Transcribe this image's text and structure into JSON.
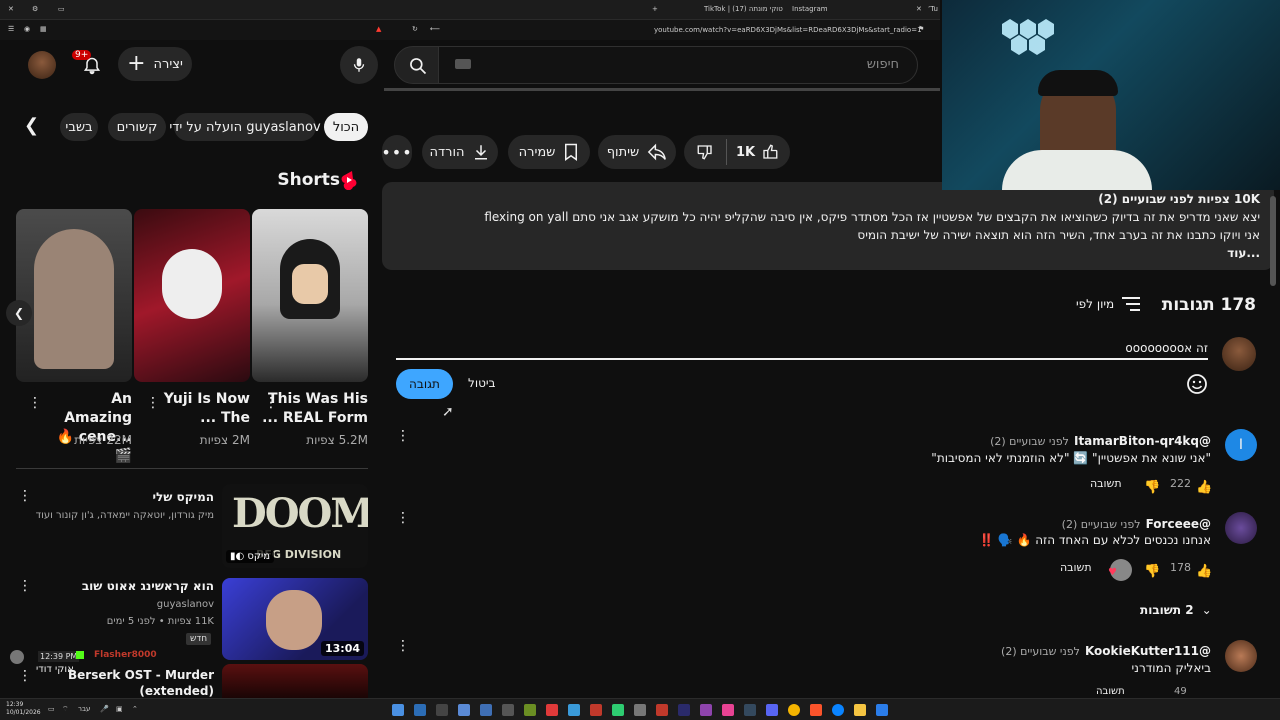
{
  "browser": {
    "tabs": [
      "TikTok | (17) טוקי מונתה",
      "Instagram",
      "’Tu"
    ],
    "url": "youtube.com/watch?v=eaRD6X3DjMs&list=RDeaRD6X3DjMs&start_radio=1"
  },
  "header": {
    "search_placeholder": "חיפוש",
    "create_label": "יצירה",
    "notif_badge": "9+"
  },
  "chips": [
    "הכול",
    "הועלה על ידי guyaslanov",
    "קשורים",
    "בשבי"
  ],
  "shorts": {
    "title": "Shorts",
    "items": [
      {
        "title_line1": "This Was His",
        "title_line2": "REAL Form ...",
        "views": "5.2M צפיות"
      },
      {
        "title_line1": "Yuji Is Now",
        "title_line2": "The ...",
        "views": "2M צפיות"
      },
      {
        "title_line1": "An Amazing",
        "title_line2": "...cene 🔥 🎬",
        "views": "22M צפיות"
      }
    ]
  },
  "recommended": [
    {
      "title": "המיקס שלי",
      "meta1": "מיק גורדון, יוטאקה יימאדה, ג'ון קונור ועוד",
      "meta2": "",
      "badge": "מיקס",
      "thumb_text": "DOOM",
      "thumb_sub": "BFG DIVISION"
    },
    {
      "title": "הוא קראשינג אאוט שוב",
      "meta1": "guyaslanov",
      "meta2": "11K צפיות • לפני 5 ימים",
      "badge": "חדש",
      "duration": "13:04"
    },
    {
      "title": "Berserk OST - Murder",
      "meta1": "(extended)",
      "meta2": "",
      "badge": ""
    }
  ],
  "actions": {
    "likes": "1K",
    "share": "שיתוף",
    "save": "שמירה",
    "download": "הורדה"
  },
  "description": {
    "stats": "10K צפיות  לפני שבועיים (2)",
    "line1": "יצא שאני מדריפ את זה בדיוק כשהוציאו את הקבצים של אפשטיין אז הכל מסתדר פיקס, אין סיבה שהקליפ יהיה כל מושקע אגב אני סתם flexing on yall",
    "line2": "אני ויוקו כתבנו את זה בערב אחד, השיר הזה הוא תוצאה ישירה של ישיבת הומיס",
    "more": "...עוד"
  },
  "comments_section": {
    "count": "178 תגובות",
    "sort_label": "מיון לפי",
    "draft": "זה אoooooooo",
    "cancel": "ביטול",
    "submit": "תגובה"
  },
  "comments": [
    {
      "author": "@ItamarBiton-qr4kq",
      "time": "לפני שבועיים (2)",
      "text": "\"אני שונא את אפשטיין\" 🔄 \"לא הוזמנתי לאי המסיבות\"",
      "likes": "222",
      "reply": "תשובה",
      "avatar_letter": "I"
    },
    {
      "author": "@Forceee",
      "time": "לפני שבועיים (2)",
      "text": "אנחנו נכנסים לכלא עם האחד הזה 🔥 🗣️ ‼️",
      "likes": "178",
      "reply": "תשובה",
      "replies": "2 תשובות"
    },
    {
      "author": "@KookieKutter111",
      "time": "לפני שבועיים (2)",
      "text": "ביאליק המודרני",
      "likes": "49",
      "reply": "תשובה"
    }
  ],
  "chat_overlay": {
    "time": "12:39 PM",
    "user": "Flasher8000",
    "msg": "אוקי דודי"
  },
  "taskbar": {
    "time": "12:39",
    "date": "10/01/2026",
    "lang": "עבר"
  },
  "colors": {
    "accent": "#3ea6ff",
    "brand_red": "#ff0033",
    "bg": "#0f0f0f"
  }
}
